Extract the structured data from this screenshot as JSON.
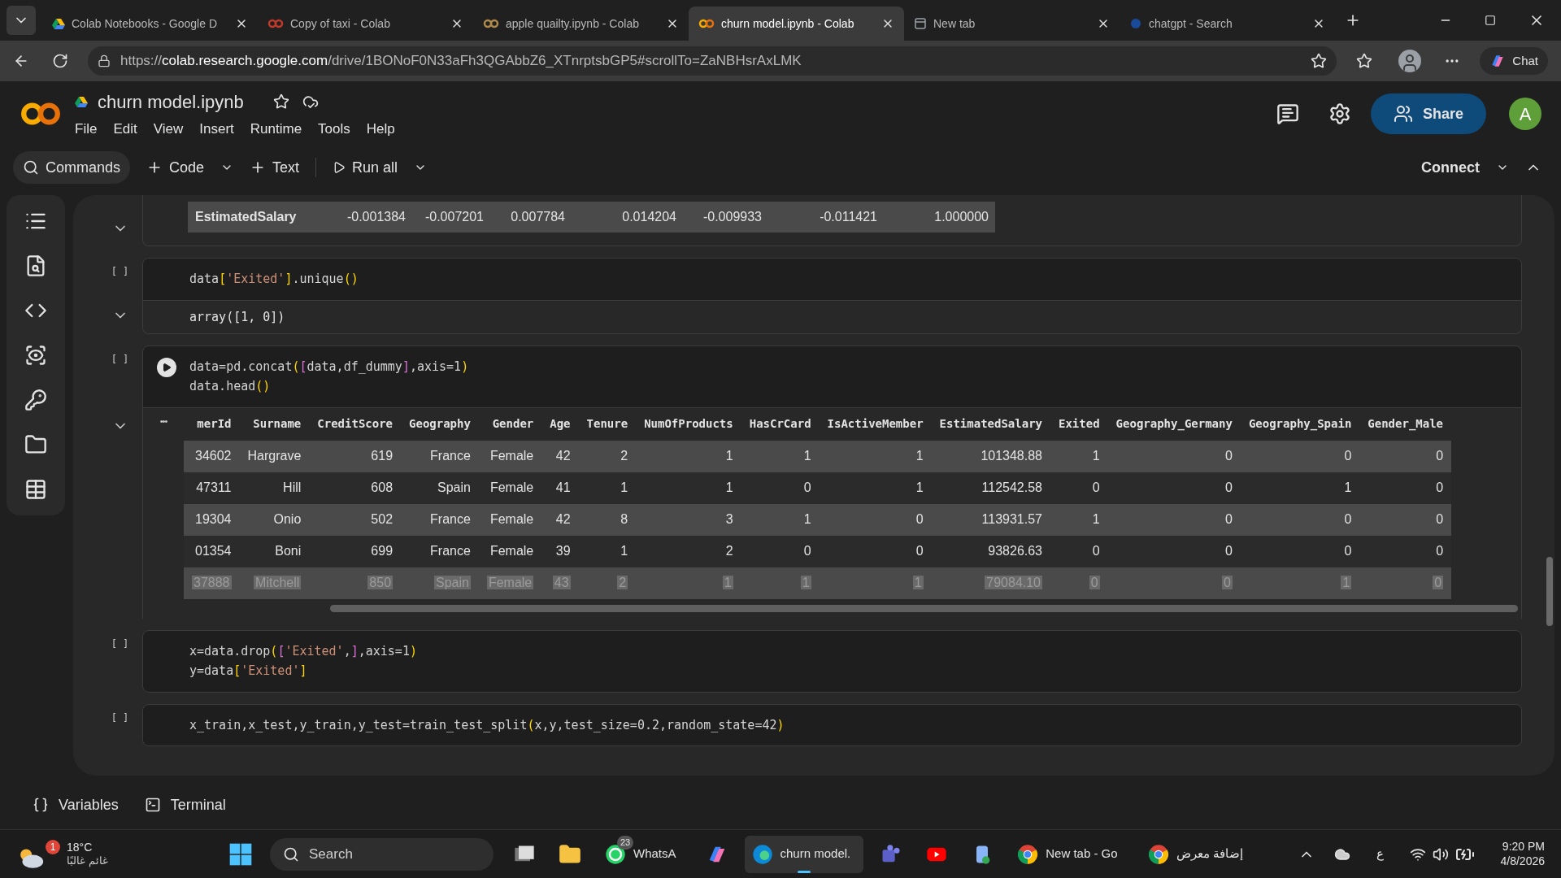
{
  "browser": {
    "tabs": [
      {
        "title": "Colab Notebooks - Google D",
        "kind": "drive",
        "selected": false
      },
      {
        "title": "Copy of taxi - Colab",
        "kind": "colab",
        "selected": false
      },
      {
        "title": "apple quailty.ipynb - Colab",
        "kind": "colab",
        "selected": false
      },
      {
        "title": "churn model.ipynb - Colab",
        "kind": "colab",
        "selected": true
      },
      {
        "title": "New tab",
        "kind": "page",
        "selected": false
      },
      {
        "title": "chatgpt - Search",
        "kind": "web",
        "selected": false
      }
    ],
    "url_scheme": "https://",
    "url_host": "colab.research.google.com",
    "url_path": "/drive/1BONoF0N33aFh3QGAbbZ6_XTnrptsbGP5#scrollTo=ZaNBHsrAxLMK",
    "chat_button": "Chat"
  },
  "colab": {
    "notebook_title": "churn model.ipynb",
    "menu": [
      "File",
      "Edit",
      "View",
      "Insert",
      "Runtime",
      "Tools",
      "Help"
    ],
    "share_button": "Share",
    "avatar": "A",
    "toolbar": {
      "commands": "Commands",
      "code": "Code",
      "text": "Text",
      "run_all": "Run all",
      "connect": "Connect"
    }
  },
  "cells": [
    {
      "kind": "table_row_output",
      "expanded": true,
      "label": "EstimatedSalary",
      "values": [
        "-0.001384",
        "-0.007201",
        "0.007784",
        "0.014204",
        "-0.009933",
        "-0.011421",
        "1.000000"
      ]
    },
    {
      "kind": "code",
      "run_label": "[ ]",
      "run_button": false,
      "code": [
        [
          {
            "text": "data",
            "kind": "plain"
          },
          {
            "text": "[",
            "kind": "bracket"
          },
          {
            "text": "'Exited'",
            "kind": "string"
          },
          {
            "text": "]",
            "kind": "bracket"
          },
          {
            "text": ".unique",
            "kind": "plain"
          },
          {
            "text": "()",
            "kind": "bracket"
          }
        ]
      ],
      "output": {
        "kind": "text",
        "expanded": true,
        "text": "array([1, 0])"
      }
    },
    {
      "kind": "code",
      "run_label": "[ ]",
      "run_button": true,
      "code": [
        [
          {
            "text": "data=pd.concat",
            "kind": "plain"
          },
          {
            "text": "(",
            "kind": "bracket"
          },
          {
            "text": "[",
            "kind": "bracket2"
          },
          {
            "text": "data,df_dummy",
            "kind": "plain"
          },
          {
            "text": "]",
            "kind": "bracket2"
          },
          {
            "text": ",axis=1",
            "kind": "plain"
          },
          {
            "text": ")",
            "kind": "bracket"
          }
        ],
        [
          {
            "text": "data.head",
            "kind": "plain"
          },
          {
            "text": "()",
            "kind": "bracket"
          }
        ]
      ],
      "output": {
        "kind": "dataframe",
        "expanded": true,
        "more": "•••",
        "columns": [
          "merId",
          "Surname",
          "CreditScore",
          "Geography",
          "Gender",
          "Age",
          "Tenure",
          "NumOfProducts",
          "HasCrCard",
          "IsActiveMember",
          "EstimatedSalary",
          "Exited",
          "Geography_Germany",
          "Geography_Spain",
          "Gender_Male"
        ],
        "rows": [
          {
            "highlighted": false,
            "cells": [
              "34602",
              "Hargrave",
              "619",
              "France",
              "Female",
              "42",
              "2",
              "1",
              "1",
              "1",
              "101348.88",
              "1",
              "0",
              "0",
              "0"
            ]
          },
          {
            "highlighted": false,
            "cells": [
              "47311",
              "Hill",
              "608",
              "Spain",
              "Female",
              "41",
              "1",
              "1",
              "0",
              "1",
              "112542.58",
              "0",
              "0",
              "1",
              "0"
            ]
          },
          {
            "highlighted": false,
            "cells": [
              "19304",
              "Onio",
              "502",
              "France",
              "Female",
              "42",
              "8",
              "3",
              "1",
              "0",
              "113931.57",
              "1",
              "0",
              "0",
              "0"
            ]
          },
          {
            "highlighted": false,
            "cells": [
              "01354",
              "Boni",
              "699",
              "France",
              "Female",
              "39",
              "1",
              "2",
              "0",
              "0",
              "93826.63",
              "0",
              "0",
              "0",
              "0"
            ]
          },
          {
            "highlighted": true,
            "cells": [
              "37888",
              "Mitchell",
              "850",
              "Spain",
              "Female",
              "43",
              "2",
              "1",
              "1",
              "1",
              "79084.10",
              "0",
              "0",
              "1",
              "0"
            ]
          }
        ]
      }
    },
    {
      "kind": "code",
      "run_label": "[ ]",
      "run_button": false,
      "code": [
        [
          {
            "text": "x=data.drop",
            "kind": "plain"
          },
          {
            "text": "(",
            "kind": "bracket"
          },
          {
            "text": "[",
            "kind": "bracket2"
          },
          {
            "text": "'Exited'",
            "kind": "string"
          },
          {
            "text": ",",
            "kind": "plain"
          },
          {
            "text": "]",
            "kind": "bracket2"
          },
          {
            "text": ",axis=1",
            "kind": "plain"
          },
          {
            "text": ")",
            "kind": "bracket"
          }
        ],
        [
          {
            "text": "y=data",
            "kind": "plain"
          },
          {
            "text": "[",
            "kind": "bracket"
          },
          {
            "text": "'Exited'",
            "kind": "string"
          },
          {
            "text": "]",
            "kind": "bracket"
          }
        ]
      ]
    },
    {
      "kind": "code",
      "run_label": "[ ]",
      "run_button": false,
      "code": [
        [
          {
            "text": "x_train,x_test,y_train,y_test=train_test_split",
            "kind": "plain"
          },
          {
            "text": "(",
            "kind": "bracket"
          },
          {
            "text": "x,y,test_size=0.2,random_state=42",
            "kind": "plain"
          },
          {
            "text": ")",
            "kind": "bracket"
          }
        ]
      ]
    }
  ],
  "bottom_bar": [
    {
      "label": "Variables",
      "kind": "variables"
    },
    {
      "label": "Terminal",
      "kind": "terminal"
    }
  ],
  "taskbar": {
    "weather": {
      "temperature": "18°C",
      "condition": "غائم غالبًا",
      "badge": "1"
    },
    "search": "Search",
    "apps": [
      {
        "kind": "taskview",
        "active": false
      },
      {
        "kind": "folder",
        "active": false
      },
      {
        "kind": "whatsapp",
        "label": "WhatsA",
        "badge": "23",
        "active": false
      },
      {
        "kind": "copilot",
        "active": false
      },
      {
        "kind": "edge",
        "label": "churn model.",
        "active": true
      },
      {
        "kind": "teams",
        "active": false
      },
      {
        "kind": "youtube",
        "active": false
      },
      {
        "kind": "app",
        "active": false
      },
      {
        "kind": "chrome",
        "label": "New tab - Go",
        "active": false
      },
      {
        "kind": "chrome",
        "label": "إضافة معرض",
        "active": false
      }
    ],
    "keyboard": "ع",
    "time": "9:20 PM",
    "date": "4/8/2026"
  }
}
